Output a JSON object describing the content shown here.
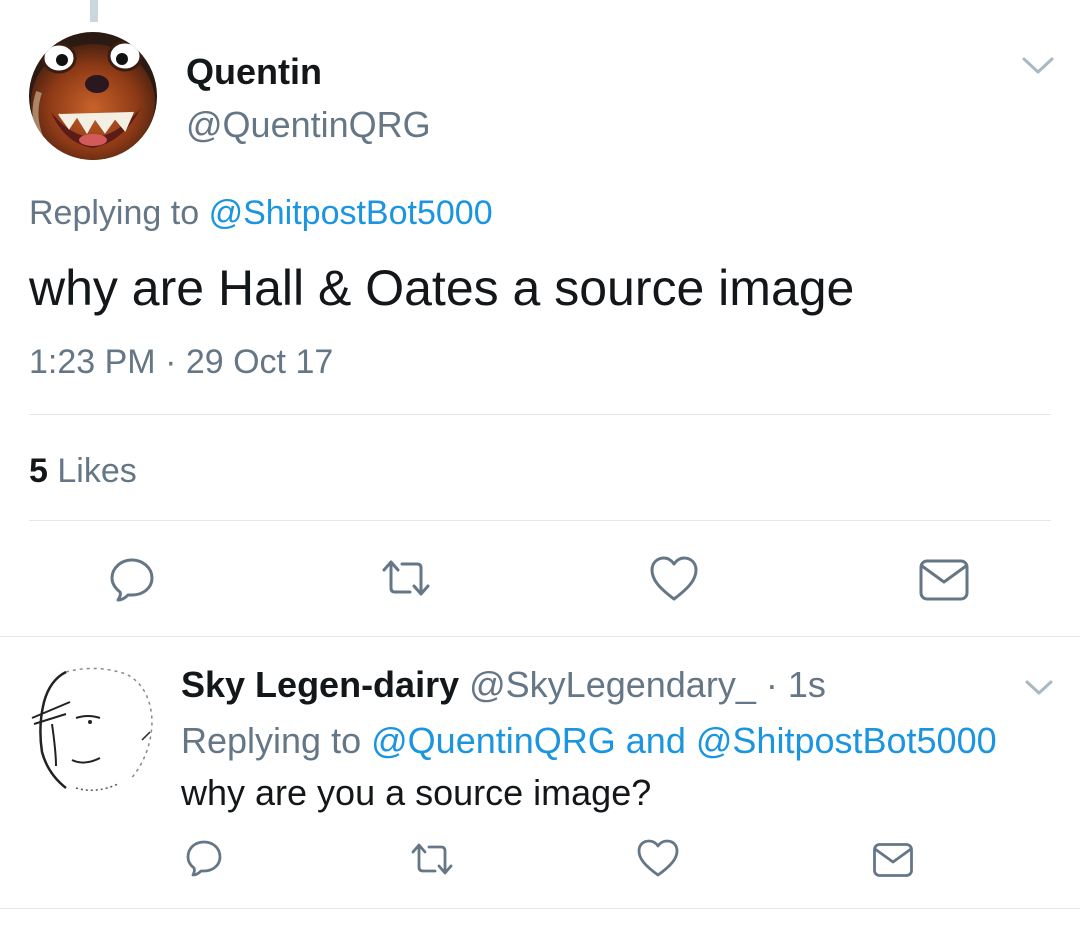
{
  "main_tweet": {
    "display_name": "Quentin",
    "handle": "@QuentinQRG",
    "replying_prefix": "Replying to",
    "replying_to": "@ShitpostBot5000",
    "text": "why are Hall & Oates a source image",
    "timestamp": "1:23 PM · 29 Oct 17",
    "likes_count": "5",
    "likes_label": "Likes",
    "actions": [
      "reply-icon",
      "retweet-icon",
      "like-icon",
      "direct-message-icon"
    ]
  },
  "reply_tweet": {
    "display_name": "Sky Legen-dairy",
    "handle": "@SkyLegendary_",
    "separator": "·",
    "age": "1s",
    "replying_prefix": "Replying to",
    "replying_to_1": "@QuentinQRG",
    "replying_join": "and",
    "replying_to_2": "@ShitpostBot5000",
    "text": "why are you a source image?",
    "actions": [
      "reply-icon",
      "retweet-icon",
      "like-icon",
      "direct-message-icon"
    ]
  },
  "colors": {
    "link": "#1b95e0",
    "secondary_text": "#657786",
    "primary_text": "#14171a",
    "divider": "#e1e8ed"
  }
}
